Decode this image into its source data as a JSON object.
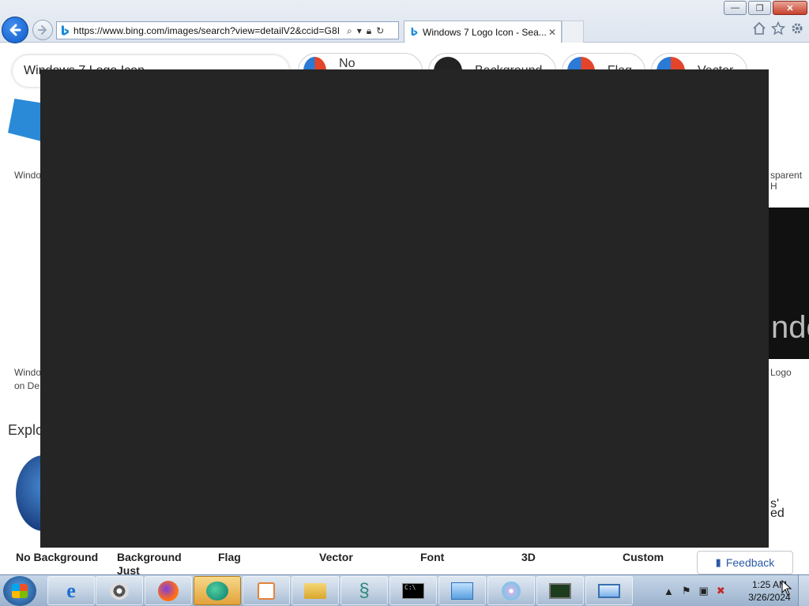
{
  "browser": {
    "url": "https://www.bing.com/images/search?view=detailV2&ccid=G8I",
    "tab_title": "Windows 7 Logo Icon - Sea...",
    "tab_close": "✕",
    "window_buttons": {
      "minimize": "—",
      "restore": "❐",
      "close": "✕"
    },
    "command_icons": [
      "home-icon",
      "star-icon",
      "gear-icon"
    ]
  },
  "page": {
    "search_query": "Windows 7 Logo Icon",
    "filter_chips": [
      "No Background",
      "Background",
      "Flag",
      "Vector"
    ],
    "side_text_left_1": "Windo",
    "side_text_left_2": "Windo",
    "side_text_left_3": "on De",
    "side_text_right_1": "sparent H",
    "side_text_right_2": "Logo",
    "right_image_text": "ndo",
    "explore_title": "Explo",
    "right_bottom_text_1": "s'",
    "right_bottom_text_2": "ed",
    "categories": [
      "No Background",
      "Background Just",
      "Flag",
      "Vector",
      "Font",
      "3D",
      "Custom"
    ],
    "feedback_label": "Feedback"
  },
  "taskbar": {
    "apps": [
      "internet-explorer",
      "raccoon-app",
      "firefox",
      "browser-app",
      "media-player",
      "file-explorer",
      "snake-app",
      "command-prompt",
      "control-panel",
      "disc-installer",
      "task-monitor",
      "remote-desktop"
    ],
    "clock_time": "1:25 AM",
    "clock_date": "3/26/2024"
  }
}
